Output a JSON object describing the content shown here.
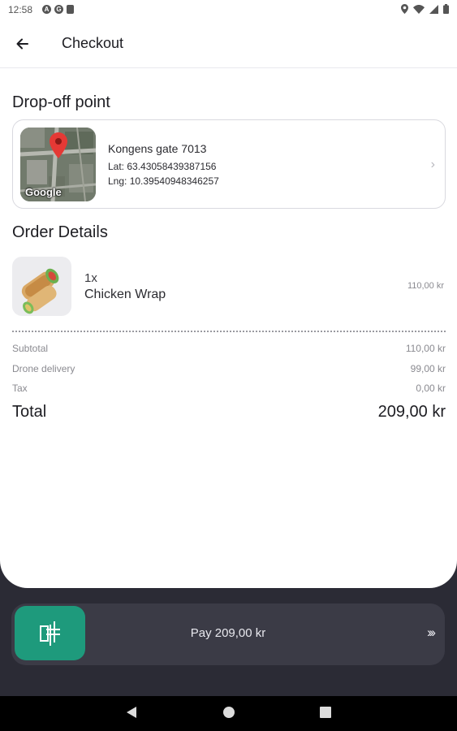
{
  "status_bar": {
    "time": "12:58",
    "left_icons": [
      "a-circle-icon",
      "g-circle-icon",
      "sd-card-icon"
    ],
    "right_icons": [
      "location-icon",
      "wifi-icon",
      "signal-icon",
      "battery-icon"
    ]
  },
  "app_bar": {
    "title": "Checkout",
    "back_icon": "arrow-left-icon"
  },
  "dropoff": {
    "section_title": "Drop-off point",
    "address": "Kongens gate 7013",
    "lat": "Lat: 63.43058439387156",
    "lng": "Lng: 10.39540948346257",
    "map_label": "Google"
  },
  "order": {
    "section_title": "Order Details",
    "items": [
      {
        "quantity": "1x",
        "name": "Chicken Wrap",
        "price": "110,00 kr"
      }
    ]
  },
  "summary": {
    "subtotal_label": "Subtotal",
    "subtotal_value": "110,00 kr",
    "delivery_label": "Drone delivery",
    "delivery_value": "99,00 kr",
    "tax_label": "Tax",
    "tax_value": "0,00 kr",
    "total_label": "Total",
    "total_value": "209,00 kr"
  },
  "pay": {
    "label": "Pay 209,00 kr",
    "arrows": "›››"
  },
  "colors": {
    "accent": "#1e9a7c",
    "dark_bg": "#2b2b35",
    "pay_bar": "#3b3b46",
    "map_pin": "#e53935"
  }
}
